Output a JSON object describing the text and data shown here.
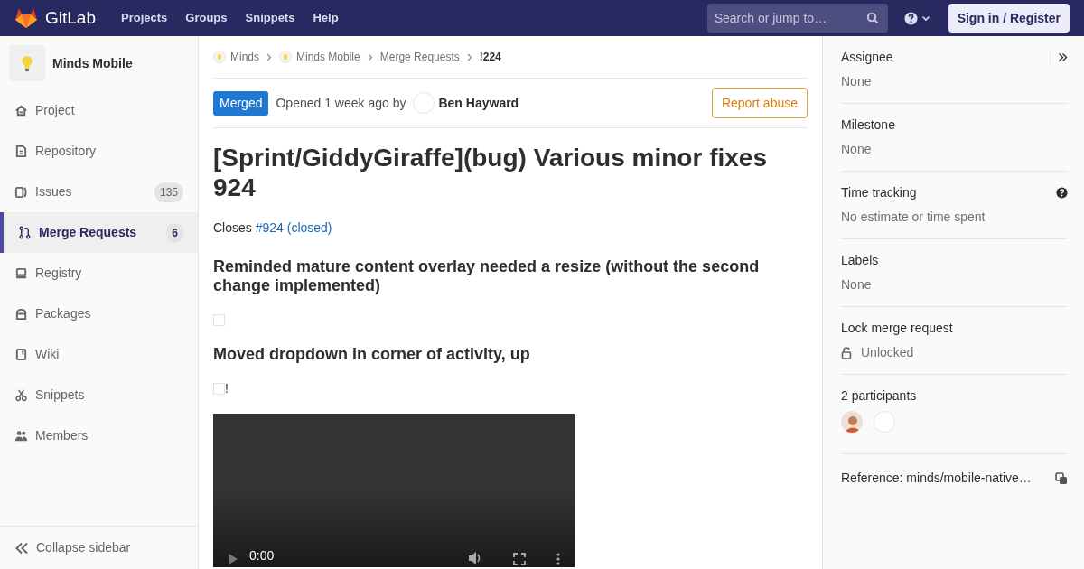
{
  "header": {
    "logo": "GitLab",
    "nav": [
      "Projects",
      "Groups",
      "Snippets",
      "Help"
    ],
    "search": {
      "placeholder": "Search or jump to…"
    },
    "sign_in": "Sign in / Register"
  },
  "sidebar": {
    "project": "Minds Mobile",
    "items": [
      {
        "label": "Project",
        "selected": false
      },
      {
        "label": "Repository",
        "selected": false
      },
      {
        "label": "Issues",
        "count": "135",
        "selected": false
      },
      {
        "label": "Merge Requests",
        "count": "6",
        "selected": true
      },
      {
        "label": "Registry",
        "selected": false
      },
      {
        "label": "Packages",
        "selected": false
      },
      {
        "label": "Wiki",
        "selected": false
      },
      {
        "label": "Snippets",
        "selected": false
      },
      {
        "label": "Members",
        "selected": false
      }
    ],
    "collapse": "Collapse sidebar"
  },
  "breadcrumbs": [
    {
      "label": "Minds",
      "kind": "avatar"
    },
    {
      "label": "Minds Mobile",
      "kind": "avatar"
    },
    {
      "label": "Merge Requests",
      "kind": "plain"
    },
    {
      "label": "!224",
      "kind": "current"
    }
  ],
  "status": {
    "badge": "Merged",
    "opened": "Opened 1 week ago by",
    "author": "Ben Hayward",
    "report": "Report abuse"
  },
  "title": "[Sprint/GiddyGiraffe](bug) Various minor fixes 924",
  "closes": {
    "text": "Closes",
    "link": "#924 (closed)"
  },
  "description": [
    {
      "kind": "heading",
      "text": "Reminded mature content overlay needed a resize (without the second change implemented)"
    },
    {
      "kind": "broken_image"
    },
    {
      "kind": "heading",
      "text": "Moved dropdown in corner of activity, up"
    },
    {
      "kind": "broken_image",
      "suffix": "!"
    },
    {
      "kind": "video",
      "time": "0:00"
    }
  ],
  "right_sidebar": [
    {
      "kind": "text",
      "label": "Assignee",
      "value": "None",
      "collapse": true
    },
    {
      "kind": "text",
      "label": "Milestone",
      "value": "None"
    },
    {
      "kind": "help",
      "label": "Time tracking",
      "value": "No estimate or time spent"
    },
    {
      "kind": "text",
      "label": "Labels",
      "value": "None"
    },
    {
      "kind": "lock",
      "label": "Lock merge request",
      "value": "Unlocked"
    },
    {
      "kind": "participants",
      "label": "2 participants",
      "participants": [
        {
          "kind": "photo"
        },
        {
          "kind": "blank"
        }
      ]
    },
    {
      "kind": "reference",
      "label": "Reference: minds/mobile-native…"
    }
  ]
}
